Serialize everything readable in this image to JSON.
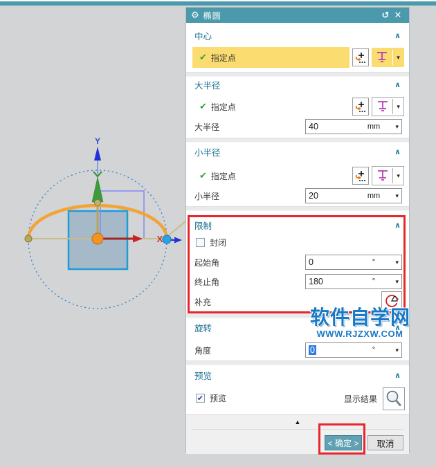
{
  "window": {
    "title": "椭圆"
  },
  "icons": {
    "gear": "⚙",
    "reset": "↺",
    "close": "✕",
    "collapse_up": "∧",
    "dropdown": "▾",
    "check": "✔",
    "checkbox_check": "✔",
    "panel_collapse": "▲"
  },
  "colors": {
    "accent_teal": "#4a99ac",
    "section_title": "#186f92",
    "highlight_yellow": "#fadc70",
    "annotation_red": "#e8262b",
    "watermark_blue": "#1a79c4",
    "selection_blue": "#2f80e0",
    "ellipse_orange": "#f2a438",
    "square_blue": "#1e9cd7"
  },
  "dialog": {
    "center": {
      "title": "中心",
      "point_label": "指定点"
    },
    "major": {
      "title": "大半径",
      "point_label": "指定点",
      "radius_label": "大半径",
      "radius_value": "40",
      "unit": "mm"
    },
    "minor": {
      "title": "小半径",
      "point_label": "指定点",
      "radius_label": "小半径",
      "radius_value": "20",
      "unit": "mm"
    },
    "limits": {
      "title": "限制",
      "closed_label": "封闭",
      "start_angle_label": "起始角",
      "start_angle_value": "0",
      "end_angle_label": "终止角",
      "end_angle_value": "180",
      "unit": "°",
      "complement_label": "补充"
    },
    "rotation": {
      "title": "旋转",
      "angle_label": "角度",
      "angle_value": "0",
      "unit": "°"
    },
    "preview": {
      "title": "预览",
      "preview_label": "预览",
      "show_result_label": "显示结果"
    },
    "footer": {
      "ok_label": "< 确定 >",
      "cancel_label": "取消"
    }
  },
  "viewport": {
    "y_axis_label": "Y",
    "x_axis_label": "X"
  },
  "watermark": {
    "title": "软件自学网",
    "url": "WWW.RJZXW.COM"
  }
}
